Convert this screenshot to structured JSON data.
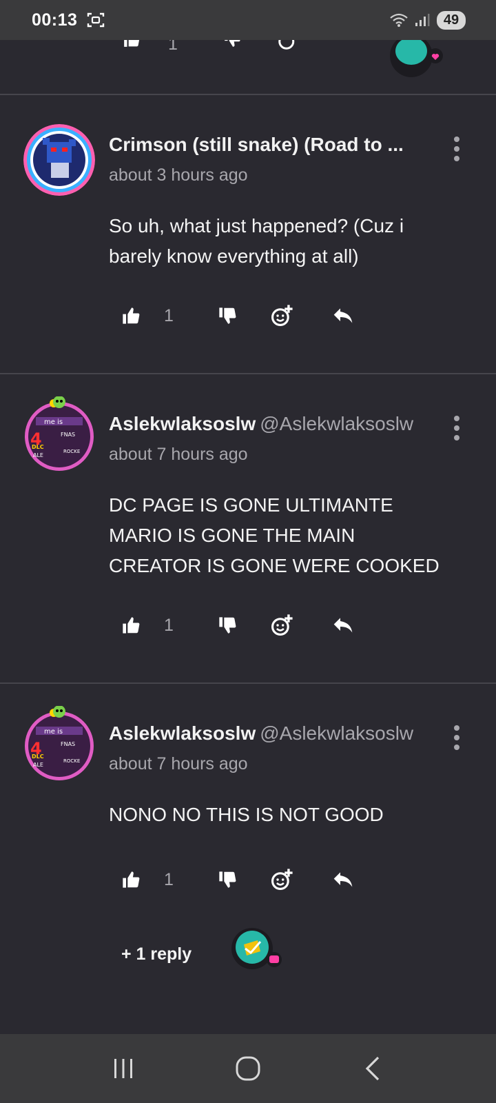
{
  "status": {
    "time": "00:13",
    "battery": "49"
  },
  "comments": [
    {
      "username": "Crimson (still snake) (Road to ...",
      "handle": "",
      "timestamp": "about 3 hours ago",
      "text_lines": [
        "So uh, what just happened? (Cuz i",
        "barely know everything at all)"
      ],
      "likes": "1"
    },
    {
      "username": "Aslekwlaksoslw",
      "handle": "@Aslekwlaksoslw",
      "timestamp": "about 7 hours ago",
      "text_lines": [
        "DC PAGE IS GONE ULTIMANTE",
        "MARIO IS GONE THE MAIN",
        "CREATOR IS GONE WERE COOKED"
      ],
      "likes": "1"
    },
    {
      "username": "Aslekwlaksoslw",
      "handle": "@Aslekwlaksoslw",
      "timestamp": "about 7 hours ago",
      "text_lines": [
        "NONO NO THIS IS NOT GOOD"
      ],
      "likes": "1",
      "replies_label": "+ 1 reply"
    }
  ],
  "partial_row": {
    "likes": "1"
  },
  "icons": {
    "like": "thumbs-up-icon",
    "dislike": "thumbs-down-icon",
    "react": "add-reaction-icon",
    "reply": "reply-icon",
    "more": "more-vertical-icon"
  },
  "colors": {
    "background": "#2a2930",
    "divider": "#46454c",
    "muted": "#a8a7ad",
    "accent_pink": "#ff3fa4"
  }
}
